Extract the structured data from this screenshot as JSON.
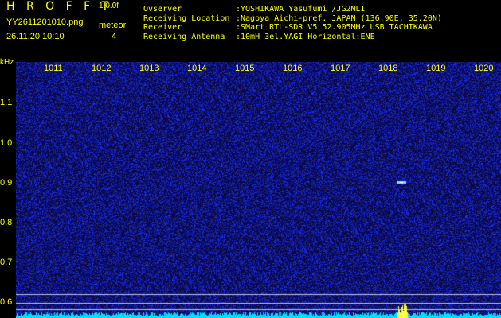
{
  "header": {
    "title": "H R O F F T",
    "version": "1.0.0f",
    "filename": "YY2611201010.png",
    "datetime": "26.11.20 10:10",
    "meteor_label": "meteor",
    "meteor_count": "4"
  },
  "info": [
    {
      "key": "Ovserver",
      "value": ":YOSHIKAWA Yasufumi /JG2MLI"
    },
    {
      "key": "Receiving Location",
      "value": ":Nagoya Aichi-pref. JAPAN (136.90E, 35.20N)"
    },
    {
      "key": "Receiver",
      "value": ":SMart RTL-SDR V5 52.905MHz USB TACHIKAWA"
    },
    {
      "key": "Receiving Antenna",
      "value": ":10mH 3el.YAGI Horizontal:ENE"
    }
  ],
  "spectrogram": {
    "y_unit": "kHz",
    "x_ticks": [
      "1011",
      "1012",
      "1013",
      "1014",
      "1015",
      "1016",
      "1017",
      "1018",
      "1019",
      "1020"
    ],
    "y_ticks": [
      "1.1",
      "1.0",
      "0.9",
      "0.8",
      "0.7",
      "0.6"
    ],
    "colors": {
      "background": "#0a0a46",
      "noise": "#1e2ad8",
      "baseline": "#00e0ff",
      "label": "#ffff00",
      "meteor": "#ffff40"
    }
  }
}
